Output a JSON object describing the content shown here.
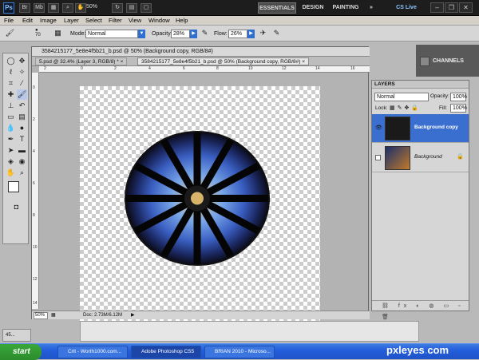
{
  "app": {
    "logo": "Ps",
    "zoom": "50%",
    "workspaces": {
      "essentials": "ESSENTIALS",
      "design": "DESIGN",
      "painting": "PAINTING",
      "more": "»"
    },
    "cslive": "CS Live",
    "window_controls": {
      "minimize": "–",
      "restore": "❐",
      "close": "✕"
    }
  },
  "menu": [
    "File",
    "Edit",
    "Image",
    "Layer",
    "Select",
    "Filter",
    "View",
    "Window",
    "Help"
  ],
  "options": {
    "brush_size": "70",
    "mode_label": "Mode:",
    "mode_value": "Normal",
    "opacity_label": "Opacity:",
    "opacity_value": "28%",
    "flow_label": "Flow:",
    "flow_value": "26%"
  },
  "document": {
    "window_title": "3584215177_5e8e4f5b21_b.psd @ 50% (Background copy, RGB/8#)",
    "tabs": [
      {
        "label": "5.psd @ 32.4% (Layer 3, RGB/8) *",
        "close": "×"
      },
      {
        "label": "3584215177_5e8e4f5b21_b.psd @ 50% (Background copy, RGB/8#)",
        "close": "×"
      }
    ],
    "ruler_numbers": [
      "2",
      "0",
      "2",
      "4",
      "6",
      "8",
      "10",
      "12",
      "14",
      "16"
    ],
    "ruler_v_numbers": [
      "0",
      "2",
      "4",
      "6",
      "8",
      "10",
      "12",
      "14"
    ],
    "zoom": "50%",
    "doc_info": "Doc: 2.73M/6.12M"
  },
  "panels": {
    "channels": "CHANNELS",
    "layers": {
      "title": "LAYERS",
      "blend_mode": "Normal",
      "opacity_label": "Opacity:",
      "opacity_value": "100%",
      "lock_label": "Lock:",
      "fill_label": "Fill:",
      "fill_value": "100%",
      "items": [
        {
          "name": "Background copy",
          "selected": true,
          "visible": true
        },
        {
          "name": "Background",
          "selected": false,
          "visible": false
        }
      ],
      "footer_icons": "⛓ fx ◐ ◍ ▭ ▫ 🗑"
    }
  },
  "mini_doc": "45...",
  "taskbar": {
    "start": "start",
    "tasks": [
      "Crit - Worth1000.com...",
      "Adobe Photoshop CS5",
      "BRIAN 2010 - Microso..."
    ]
  },
  "watermark": {
    "text": "pxleyes",
    "dot": ".",
    "tld": "com"
  },
  "colors": {
    "accent": "#2f6fd0",
    "taskbar": "#245edb",
    "selected_layer": "#3a6fd0"
  }
}
